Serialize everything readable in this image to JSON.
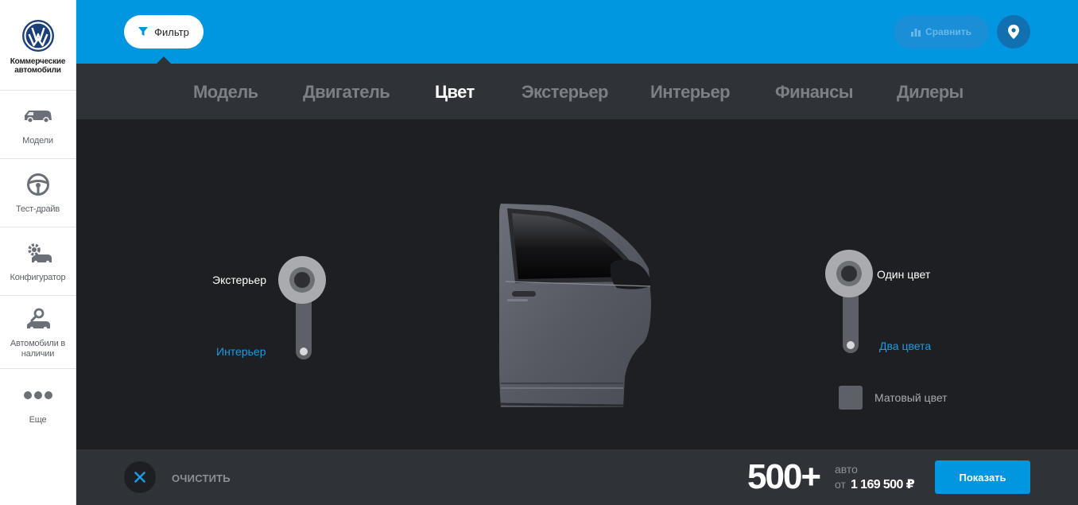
{
  "brand": {
    "name": "Коммерческие автомобили",
    "logo_icon": "vw-logo-icon"
  },
  "sidebar": {
    "items": [
      {
        "label": "Модели",
        "icon": "van-icon"
      },
      {
        "label": "Тест-драйв",
        "icon": "steering-wheel-icon"
      },
      {
        "label": "Конфигуратор",
        "icon": "gear-car-icon"
      },
      {
        "label": "Автомобили в наличии",
        "icon": "car-search-icon"
      },
      {
        "label": "Еще",
        "icon": "more-dots-icon"
      }
    ]
  },
  "header": {
    "filter_label": "Фильтр",
    "compare_label": "Сравнить",
    "accent_color": "#0096e0"
  },
  "tabs": [
    {
      "label": "Модель",
      "active": false
    },
    {
      "label": "Двигатель",
      "active": false
    },
    {
      "label": "Цвет",
      "active": true
    },
    {
      "label": "Экстерьер",
      "active": false
    },
    {
      "label": "Интерьер",
      "active": false
    },
    {
      "label": "Финансы",
      "active": false
    },
    {
      "label": "Дилеры",
      "active": false
    }
  ],
  "color_filter": {
    "area_switch": {
      "top_label": "Экстерьер",
      "bottom_label": "Интерьер",
      "selected": "Экстерьер"
    },
    "tone_switch": {
      "top_label": "Один цвет",
      "bottom_label": "Два цвета",
      "selected": "Один цвет"
    },
    "matte": {
      "label": "Матовый цвет",
      "checked": false
    }
  },
  "footer": {
    "clear_label": "ОЧИСТИТЬ",
    "count": "500+",
    "count_unit": "авто",
    "price_prefix": "от",
    "price": "1 169 500 ₽",
    "show_label": "Показать"
  }
}
